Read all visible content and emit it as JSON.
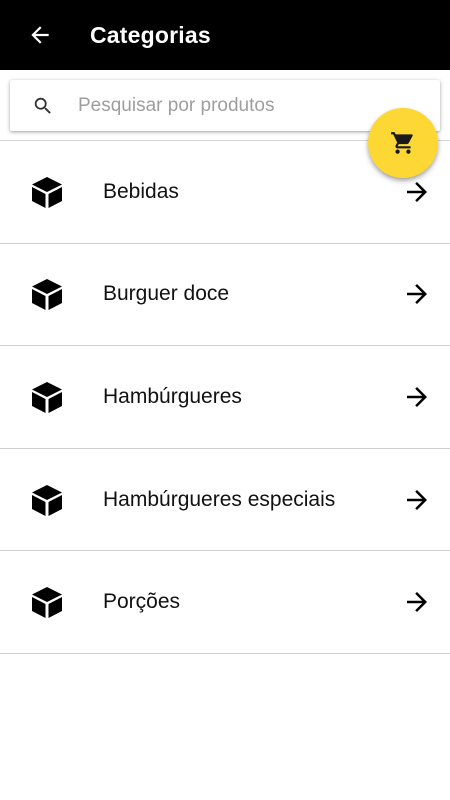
{
  "header": {
    "back_icon": "arrow-left-icon",
    "title": "Categorias"
  },
  "search": {
    "icon": "search-icon",
    "placeholder": "Pesquisar por produtos",
    "value": ""
  },
  "cart_button": {
    "icon": "cart-icon",
    "color": "#fdd835"
  },
  "categories": [
    {
      "label": "Bebidas",
      "icon": "cube-icon"
    },
    {
      "label": "Burguer doce",
      "icon": "cube-icon"
    },
    {
      "label": "Hambúrgueres",
      "icon": "cube-icon"
    },
    {
      "label": "Hambúrgueres especiais",
      "icon": "cube-icon"
    },
    {
      "label": "Porções",
      "icon": "cube-icon"
    }
  ],
  "colors": {
    "app_bar": "#000000",
    "accent": "#fdd835"
  }
}
